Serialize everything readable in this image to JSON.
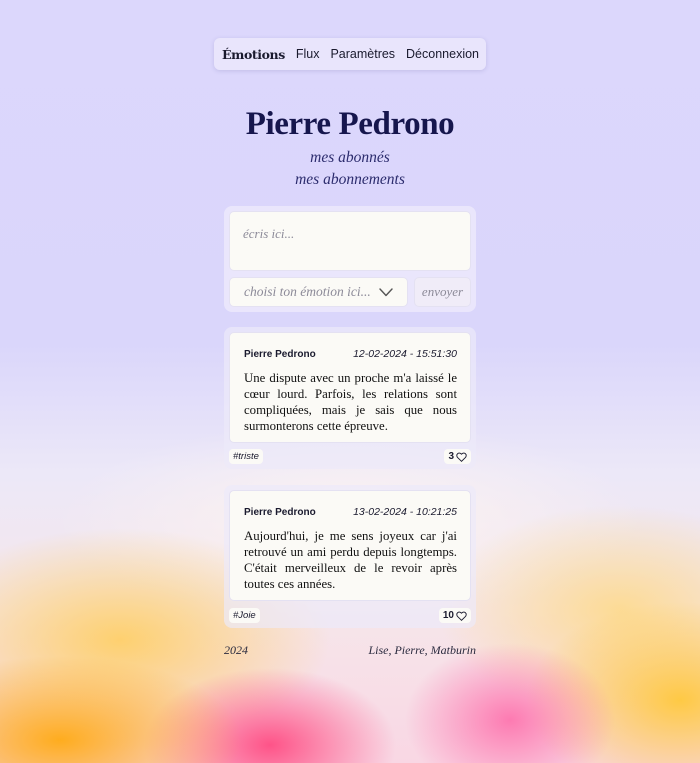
{
  "nav": {
    "brand": "Émotions",
    "links": [
      "Flux",
      "Paramètres",
      "Déconnexion"
    ]
  },
  "profile": {
    "name": "Pierre Pedrono",
    "followers_link": "mes abonnés",
    "following_link": "mes abonnements"
  },
  "composer": {
    "text_placeholder": "écris ici...",
    "emotion_placeholder": "choisi ton émotion ici...",
    "send_label": "envoyer"
  },
  "posts": [
    {
      "author": "Pierre Pedrono",
      "date": "12-02-2024 - 15:51:30",
      "text": "Une dispute avec un proche m'a laissé le cœur lourd. Parfois, les relations sont compliquées, mais je sais que nous surmonterons cette épreuve.",
      "tag": "#triste",
      "likes": "3"
    },
    {
      "author": "Pierre Pedrono",
      "date": "13-02-2024 - 10:21:25",
      "text": "Aujourd'hui, je me sens joyeux car j'ai retrouvé un ami perdu depuis longtemps. C'était merveilleux de le revoir après toutes ces années.",
      "tag": "#Joie",
      "likes": "10"
    }
  ],
  "footer": {
    "year": "2024",
    "credits": "Lise, Pierre, Matburin"
  },
  "icons": {
    "chevron": "chevron-down-icon",
    "heart": "heart-icon"
  }
}
